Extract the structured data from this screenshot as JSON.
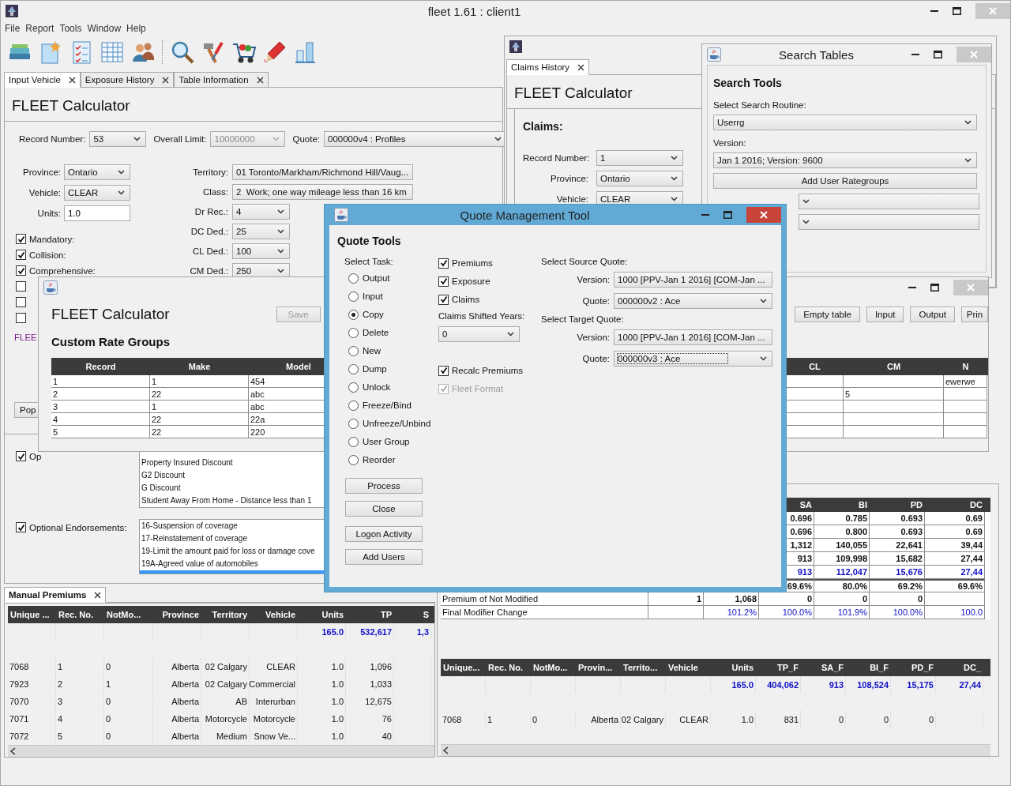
{
  "window": {
    "title": "fleet 1.61 : client1"
  },
  "menu": [
    "File",
    "Report",
    "Tools",
    "Window",
    "Help"
  ],
  "input_frame": {
    "tabs": [
      {
        "label": "Input Vehicle",
        "selected": true
      },
      {
        "label": "Exposure History",
        "selected": false
      },
      {
        "label": "Table Information",
        "selected": false
      }
    ],
    "heading": "FLEET Calculator",
    "top_fields": [
      {
        "label": "Record Number:",
        "value": "53",
        "disabled": false
      },
      {
        "label": "Overall Limit:",
        "value": "10000000",
        "disabled": true
      },
      {
        "label": "Quote:",
        "value": "000000v4 : Profiles",
        "disabled": false
      }
    ],
    "vehicle_fields": [
      {
        "kind": "select",
        "label": "Province:",
        "value": "Ontario"
      },
      {
        "kind": "select",
        "label": "Vehicle:",
        "value": "CLEAR"
      },
      {
        "kind": "input",
        "label": "Units:",
        "value": "1.0"
      }
    ],
    "coverages": [
      {
        "label": "Mandatory:",
        "checked": true
      },
      {
        "label": "Collision:",
        "checked": true
      },
      {
        "label": "Comprehensive:",
        "checked": true
      },
      {
        "checked": false
      },
      {
        "checked": false
      },
      {
        "checked": false
      }
    ],
    "rating_fields": [
      {
        "label": "Territory:",
        "value": "01 Toronto/Markham/Richmond Hill/Vaug..."
      },
      {
        "label": "Class:",
        "value": "2  Work; one way mileage less than 16 km"
      },
      {
        "label": "Dr Rec.:",
        "value": "4"
      },
      {
        "label": "DC Ded.:",
        "value": "25"
      },
      {
        "label": "CL Ded.:",
        "value": "100"
      },
      {
        "label": "CM Ded.:",
        "value": "250"
      }
    ],
    "note": "FLEE",
    "pop_button": "Pop",
    "discounts": {
      "label": "Op",
      "checked": true,
      "items": [
        "Property Insured Discount",
        "G2 Discount",
        "G Discount",
        "Student Away From Home - Distance less than 1"
      ]
    },
    "endorsements": {
      "label": "Optional Endorsements:",
      "checked": true,
      "items": [
        {
          "text": "16-Suspension of coverage",
          "selected": false
        },
        {
          "text": "17-Reinstatement of coverage",
          "selected": false
        },
        {
          "text": "19-Limit the amount paid for loss or damage cove",
          "selected": false
        },
        {
          "text": "19A-Agreed value of automobiles",
          "selected": false
        },
        {
          "selected": true
        }
      ]
    }
  },
  "manual_premiums": {
    "tab": "Manual Premiums",
    "columns": [
      "Unique ...",
      "Rec. No.",
      "NotMo...",
      "Province",
      "Territory",
      "Vehicle",
      "Units",
      "TP",
      "S"
    ],
    "rows": [
      {
        "kind": "total",
        "cells": [
          "",
          "",
          "",
          "",
          "",
          "",
          "165.0",
          "532,617",
          "1,3"
        ]
      },
      {
        "kind": "data",
        "cells": [
          "7068",
          "1",
          "0",
          "Alberta",
          "02 Calgary",
          "CLEAR",
          "1.0",
          "1,096",
          ""
        ]
      },
      {
        "kind": "data",
        "cells": [
          "7923",
          "2",
          "1",
          "Alberta",
          "02 Calgary",
          "Commercial",
          "1.0",
          "1,033",
          ""
        ]
      },
      {
        "kind": "data",
        "cells": [
          "7070",
          "3",
          "0",
          "Alberta",
          "AB",
          "Interurban",
          "1.0",
          "12,675",
          ""
        ]
      },
      {
        "kind": "data",
        "cells": [
          "7071",
          "4",
          "0",
          "Alberta",
          "Motorcycle",
          "Motorcycle",
          "1.0",
          "76",
          ""
        ]
      },
      {
        "kind": "data",
        "cells": [
          "7072",
          "5",
          "0",
          "Alberta",
          "Medium",
          "Snow Ve...",
          "1.0",
          "40",
          ""
        ]
      }
    ]
  },
  "claims_window": {
    "tab": "Claims History",
    "heading": "FLEET Calculator",
    "section": "Claims:",
    "fields": [
      {
        "label": "Record Number:",
        "value": "1"
      },
      {
        "label": "Province:",
        "value": "Ontario"
      },
      {
        "label": "Vehicle:",
        "value": "CLEAR"
      }
    ]
  },
  "summary_window": {
    "columns": [
      "",
      "",
      "",
      "SA",
      "BI",
      "PD",
      "DC"
    ],
    "rows": [
      {
        "kind": "bold",
        "cells": [
          "",
          "",
          "",
          "0.696",
          "0.785",
          "0.693",
          "0.69"
        ]
      },
      {
        "kind": "bold",
        "cells": [
          "",
          "",
          "",
          "0.696",
          "0.800",
          "0.693",
          "0.69"
        ]
      },
      {
        "kind": "bold",
        "cells": [
          "",
          "",
          "",
          "1,312",
          "140,055",
          "22,641",
          "39,44"
        ]
      },
      {
        "kind": "bold",
        "cells": [
          "",
          "",
          "",
          "913",
          "109,998",
          "15,682",
          "27,44"
        ]
      },
      {
        "kind": "blue",
        "cells": [
          "",
          "",
          "",
          "913",
          "112,047",
          "15,676",
          "27,44"
        ]
      },
      {
        "kind": "rule",
        "cells": [
          "",
          "",
          "",
          "69.6%",
          "80.0%",
          "69.2%",
          "69.6%"
        ]
      },
      {
        "kind": "bold",
        "cells": [
          "Premium of Not Modified",
          "1",
          "1,068",
          "0",
          "0",
          "0",
          ""
        ]
      },
      {
        "kind": "light",
        "cells": [
          "Final Modifier Change",
          "",
          "101.2%",
          "100.0%",
          "101.9%",
          "100.0%",
          "100.0"
        ]
      }
    ],
    "premium_table": {
      "columns": [
        "Unique...",
        "Rec. No.",
        "NotMo...",
        "Provin...",
        "Territo...",
        "Vehicle",
        "Units",
        "TP_F",
        "SA_F",
        "BI_F",
        "PD_F",
        "DC_"
      ],
      "rows": [
        {
          "kind": "total",
          "cells": [
            "",
            "",
            "",
            "",
            "",
            "",
            "165.0",
            "404,062",
            "913",
            "108,524",
            "15,175",
            "27,44"
          ]
        },
        {
          "kind": "data",
          "cells": [
            "7068",
            "1",
            "0",
            "Alberta",
            "02 Calgary",
            "CLEAR",
            "1.0",
            "831",
            "0",
            "0",
            "0",
            ""
          ]
        }
      ]
    }
  },
  "search_window": {
    "title": "Search Tables",
    "heading": "Search Tools",
    "routine_label": "Select Search Routine:",
    "routine": "Userrg",
    "version_label": "Version:",
    "version": "Jan 1 2016; Version: 9600",
    "button": "Add User Rategroups"
  },
  "rate_groups_window": {
    "heading": "FLEET Calculator",
    "save_button": {
      "label": "Save",
      "disabled": true
    },
    "section": "Custom Rate Groups",
    "buttons": [
      "Empty table",
      "Input",
      "Output",
      "Prin"
    ],
    "columns": [
      "Record",
      "Make",
      "Model",
      "CL",
      "CM",
      "N"
    ],
    "rows": [
      [
        "1",
        "1",
        "454",
        "",
        "",
        "ewerwe"
      ],
      [
        "2",
        "22",
        "abc",
        "",
        "5",
        ""
      ],
      [
        "3",
        "1",
        "abc",
        "",
        "",
        ""
      ],
      [
        "4",
        "22",
        "22a",
        "",
        "",
        ""
      ],
      [
        "5",
        "22",
        "220",
        "",
        "",
        ""
      ]
    ]
  },
  "quote_tool": {
    "title": "Quote Management Tool",
    "heading": "Quote Tools",
    "task_label": "Select Task:",
    "tasks": [
      {
        "label": "Output",
        "selected": false
      },
      {
        "label": "Input",
        "selected": false
      },
      {
        "label": "Copy",
        "selected": true
      },
      {
        "label": "Delete",
        "selected": false
      },
      {
        "label": "New",
        "selected": false
      },
      {
        "label": "Dump",
        "selected": false
      },
      {
        "label": "Unlock",
        "selected": false
      },
      {
        "label": "Freeze/Bind",
        "selected": false
      },
      {
        "label": "Unfreeze/Unbind",
        "selected": false
      },
      {
        "label": "User Group",
        "selected": false
      },
      {
        "label": "Reorder",
        "selected": false
      }
    ],
    "buttons": [
      "Process",
      "Close",
      "Logon Activity",
      "Add Users"
    ],
    "options": [
      {
        "label": "Premiums",
        "checked": true,
        "disabled": false
      },
      {
        "label": "Exposure",
        "checked": true,
        "disabled": false
      },
      {
        "label": "Claims",
        "checked": true,
        "disabled": false
      }
    ],
    "shift_label": "Claims Shifted Years:",
    "shift_value": "0",
    "extra_options": [
      {
        "label": "Recalc Premiums",
        "checked": true,
        "disabled": false
      },
      {
        "label": "Fleet Format",
        "checked": true,
        "disabled": true
      }
    ],
    "source": {
      "label": "Select Source Quote:",
      "fields": [
        {
          "label": "Version:",
          "value": "1000 [PPV-Jan 1 2016] [COM-Jan ...",
          "focused": false
        },
        {
          "label": "Quote:",
          "value": "000000v2 : Ace",
          "focused": false
        }
      ]
    },
    "target": {
      "label": "Select Target Quote:",
      "fields": [
        {
          "label": "Version:",
          "value": "1000 [PPV-Jan 1 2016] [COM-Jan ...",
          "focused": false
        },
        {
          "label": "Quote:",
          "value": "000000v3 : Ace",
          "focused": true
        }
      ]
    }
  }
}
